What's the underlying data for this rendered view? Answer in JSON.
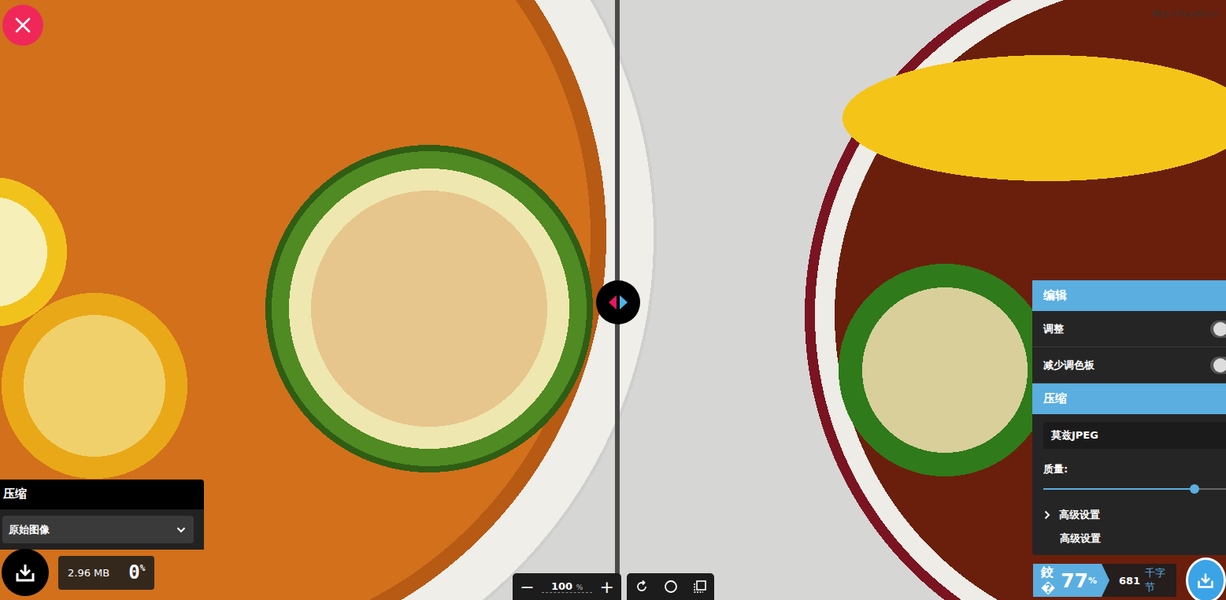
{
  "watermark": "网友小宋xyzbz.cn",
  "left_panel": {
    "title": "压缩",
    "method": "原始图像"
  },
  "left_stats": {
    "size": "2.96 MB",
    "percent_value": "0",
    "percent_sign": "%"
  },
  "zoom": {
    "minus": "−",
    "value": "100",
    "unit": "%",
    "plus": "+"
  },
  "right_panel": {
    "edit_title": "编辑",
    "options": [
      {
        "label": "调整",
        "on": false
      },
      {
        "label": "减少调色板",
        "on": false
      }
    ],
    "compress_title": "压缩",
    "method": "莫兹JPEG",
    "quality_label": "质量:",
    "quality": {
      "level": 0.82
    },
    "advanced": [
      {
        "label": "高级设置",
        "kind": "expander",
        "expanded": false
      },
      {
        "label": "高级设置",
        "kind": "plain"
      }
    ]
  },
  "right_stats": {
    "prefix": "鉸�",
    "percent_value": "77",
    "percent_sign": "%",
    "size_value": "681",
    "size_unit": "千字节"
  }
}
